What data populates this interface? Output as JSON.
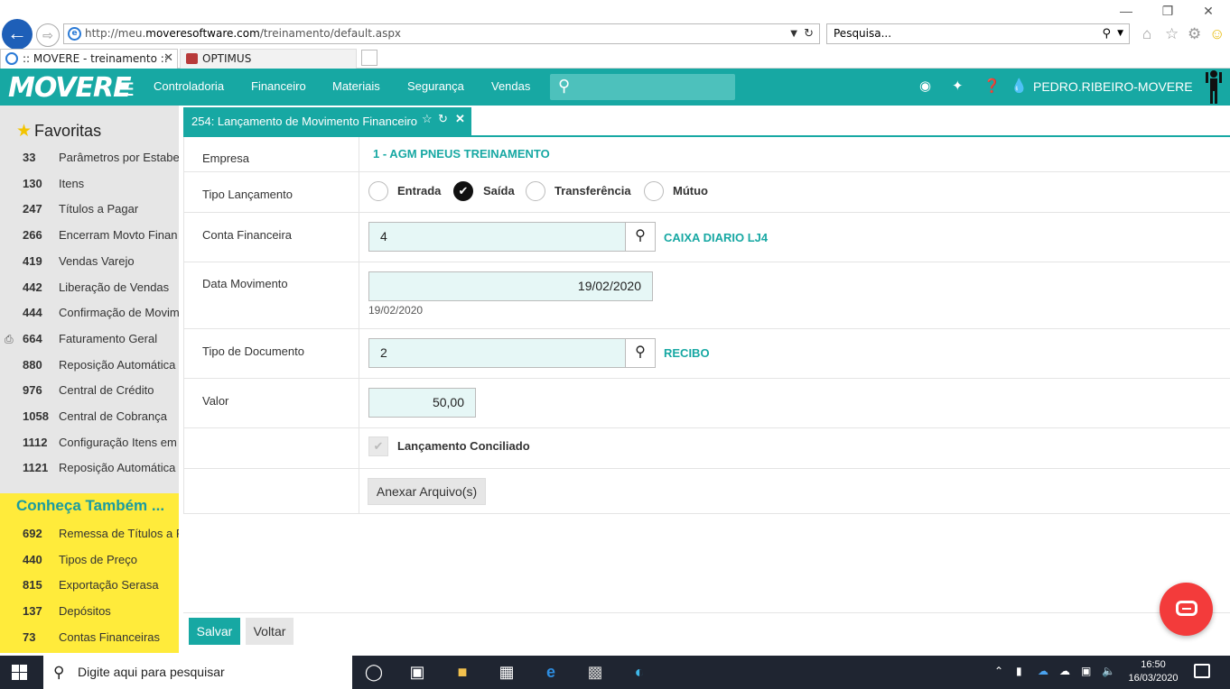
{
  "browser": {
    "url_prefix": "http://meu.",
    "url_domain": "moveresoftware.com",
    "url_path": "/treinamento/default.aspx",
    "search_placeholder": "Pesquisa...",
    "tabs": [
      {
        "label": ":: MOVERE - treinamento ::"
      },
      {
        "label": "OPTIMUS"
      }
    ]
  },
  "app": {
    "logo": "MOVERE",
    "nav": [
      "Controladoria",
      "Financeiro",
      "Materiais",
      "Segurança",
      "Vendas"
    ],
    "user": "PEDRO.RIBEIRO-MOVERE",
    "brand_color": "#17a8a3"
  },
  "sidebar": {
    "favorites_title": "Favoritas",
    "favorites": [
      {
        "num": "33",
        "label": "Parâmetros por Estabe"
      },
      {
        "num": "130",
        "label": "Itens"
      },
      {
        "num": "247",
        "label": "Títulos a Pagar"
      },
      {
        "num": "266",
        "label": "Encerram Movto Finan"
      },
      {
        "num": "419",
        "label": "Vendas Varejo"
      },
      {
        "num": "442",
        "label": "Liberação de Vendas"
      },
      {
        "num": "444",
        "label": "Confirmação de Movim"
      },
      {
        "num": "664",
        "label": "Faturamento Geral"
      },
      {
        "num": "880",
        "label": "Reposição Automática"
      },
      {
        "num": "976",
        "label": "Central de Crédito"
      },
      {
        "num": "1058",
        "label": "Central de Cobrança"
      },
      {
        "num": "1112",
        "label": "Configuração Itens em"
      },
      {
        "num": "1121",
        "label": "Reposição Automática"
      }
    ],
    "conheca_title": "Conheça Também ...",
    "conheca": [
      {
        "num": "692",
        "label": "Remessa de Títulos a F"
      },
      {
        "num": "440",
        "label": "Tipos de Preço"
      },
      {
        "num": "815",
        "label": "Exportação Serasa"
      },
      {
        "num": "137",
        "label": "Depósitos"
      },
      {
        "num": "73",
        "label": "Contas Financeiras"
      }
    ]
  },
  "panel": {
    "title": "254: Lançamento de Movimento Financeiro",
    "labels": {
      "empresa": "Empresa",
      "tipo_lancamento": "Tipo Lançamento",
      "conta_financeira": "Conta Financeira",
      "data_movimento": "Data Movimento",
      "tipo_documento": "Tipo de Documento",
      "valor": "Valor"
    },
    "empresa_value": "1 - AGM PNEUS TREINAMENTO",
    "tipo_options": [
      {
        "label": "Entrada",
        "selected": false
      },
      {
        "label": "Saída",
        "selected": true
      },
      {
        "label": "Transferência",
        "selected": false
      },
      {
        "label": "Mútuo",
        "selected": false
      }
    ],
    "conta_value": "4",
    "conta_desc": "CAIXA DIARIO LJ4",
    "data_value": "19/02/2020",
    "data_sub": "19/02/2020",
    "tipodoc_value": "2",
    "tipodoc_desc": "RECIBO",
    "valor_value": "50,00",
    "conciliado_label": "Lançamento Conciliado",
    "anexar_label": "Anexar Arquivo(s)"
  },
  "footer": {
    "salvar": "Salvar",
    "voltar": "Voltar"
  },
  "taskbar": {
    "search_placeholder": "Digite aqui para pesquisar",
    "time": "16:50",
    "date": "16/03/2020"
  }
}
